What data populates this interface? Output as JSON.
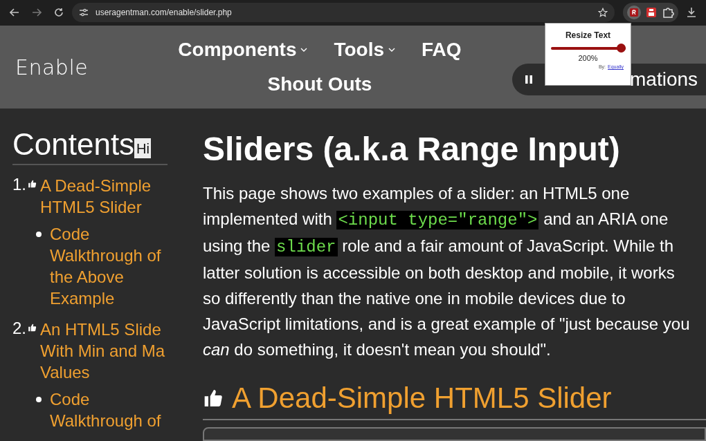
{
  "browser": {
    "url": "useragentman.com/enable/slider.php"
  },
  "site": {
    "logo": "Enable",
    "nav": [
      {
        "label": "Components",
        "dropdown": true
      },
      {
        "label": "Tools",
        "dropdown": true
      },
      {
        "label": "FAQ",
        "dropdown": false
      },
      {
        "label": "Shout Outs",
        "dropdown": false
      }
    ],
    "pause_button": "mations"
  },
  "extension_popup": {
    "title": "Resize Text",
    "slider": {
      "level": 1.0
    },
    "reading": "200%",
    "credit": "By:",
    "credit_link": "Equally"
  },
  "sidebar": {
    "title": "Contents",
    "hide_button": "Hi",
    "items": [
      {
        "number": "1.",
        "lines": [
          "A Dead-Simple",
          "HTML5 Slider"
        ],
        "children": [
          {
            "lines": [
              "Code",
              "Walkthrough of",
              "the Above",
              "Example"
            ]
          }
        ]
      },
      {
        "number": "2.",
        "lines": [
          "An HTML5 Slide",
          "With Min and Ma",
          "Values"
        ],
        "children": [
          {
            "lines": [
              "Code",
              "Walkthrough of"
            ]
          }
        ]
      }
    ]
  },
  "main": {
    "title": "Sliders (a.k.a Range Input)",
    "paragraph": [
      [
        {
          "kind": "text",
          "text": "This page shows two examples of a slider: an HTML5 one"
        }
      ],
      [
        {
          "kind": "text",
          "text": "implemented with "
        },
        {
          "kind": "code",
          "text": "<input type=\"range\">"
        },
        {
          "kind": "text",
          "text": " and an ARIA one"
        }
      ],
      [
        {
          "kind": "text",
          "text": "using the "
        },
        {
          "kind": "code",
          "text": "slider"
        },
        {
          "kind": "text",
          "text": " role and a fair amount of JavaScript. While th"
        }
      ],
      [
        {
          "kind": "text",
          "text": "latter solution is accessible on both desktop and mobile, it works"
        }
      ],
      [
        {
          "kind": "text",
          "text": "so differently than the native one in mobile devices due to"
        }
      ],
      [
        {
          "kind": "text",
          "text": "JavaScript limitations, and is a great example of \"just because you"
        }
      ],
      [
        {
          "kind": "em",
          "text": "can"
        },
        {
          "kind": "text",
          "text": " do something, it doesn't mean you should\"."
        }
      ]
    ],
    "section_heading": "A Dead-Simple HTML5 Slider"
  }
}
